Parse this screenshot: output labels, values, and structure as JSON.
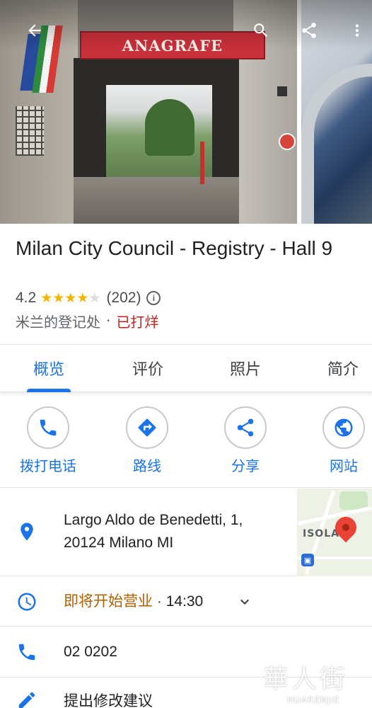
{
  "hero": {
    "sign_text": "ANAGRAFE",
    "back_icon": "arrow-back-icon",
    "search_icon": "search-icon",
    "share_icon": "share-icon",
    "more_icon": "more-vert-icon"
  },
  "place": {
    "title": "Milan City Council - Registry - Hall 9",
    "rating": "4.2",
    "stars": 4.2,
    "reviews_count": "(202)",
    "category": "米兰的登记处",
    "separator": "·",
    "status": "已打烊"
  },
  "tabs": [
    {
      "label": "概览",
      "active": true
    },
    {
      "label": "评价",
      "active": false
    },
    {
      "label": "照片",
      "active": false
    },
    {
      "label": "简介",
      "active": false
    }
  ],
  "actions": [
    {
      "label": "拨打电话",
      "icon": "phone-icon"
    },
    {
      "label": "路线",
      "icon": "directions-icon"
    },
    {
      "label": "分享",
      "icon": "share-icon"
    },
    {
      "label": "网站",
      "icon": "globe-icon"
    }
  ],
  "address": {
    "line1": "Largo Aldo de Benedetti, 1,",
    "line2": "20124 Milano MI",
    "icon": "location-pin-icon",
    "map_label": "ISOLA"
  },
  "hours": {
    "status": "即将开始营业",
    "separator": "·",
    "time": "14:30",
    "icon": "clock-icon"
  },
  "phone": {
    "number": "02 0202",
    "icon": "phone-icon"
  },
  "suggest_edit": {
    "label": "提出修改建议",
    "icon": "edit-pencil-icon"
  },
  "watermark": {
    "big": "華人街",
    "small": "HUARENJIE"
  },
  "colors": {
    "accent": "#1a73e8",
    "closed": "#c5221f",
    "opening_soon": "#b06000",
    "star": "#f5b400"
  }
}
